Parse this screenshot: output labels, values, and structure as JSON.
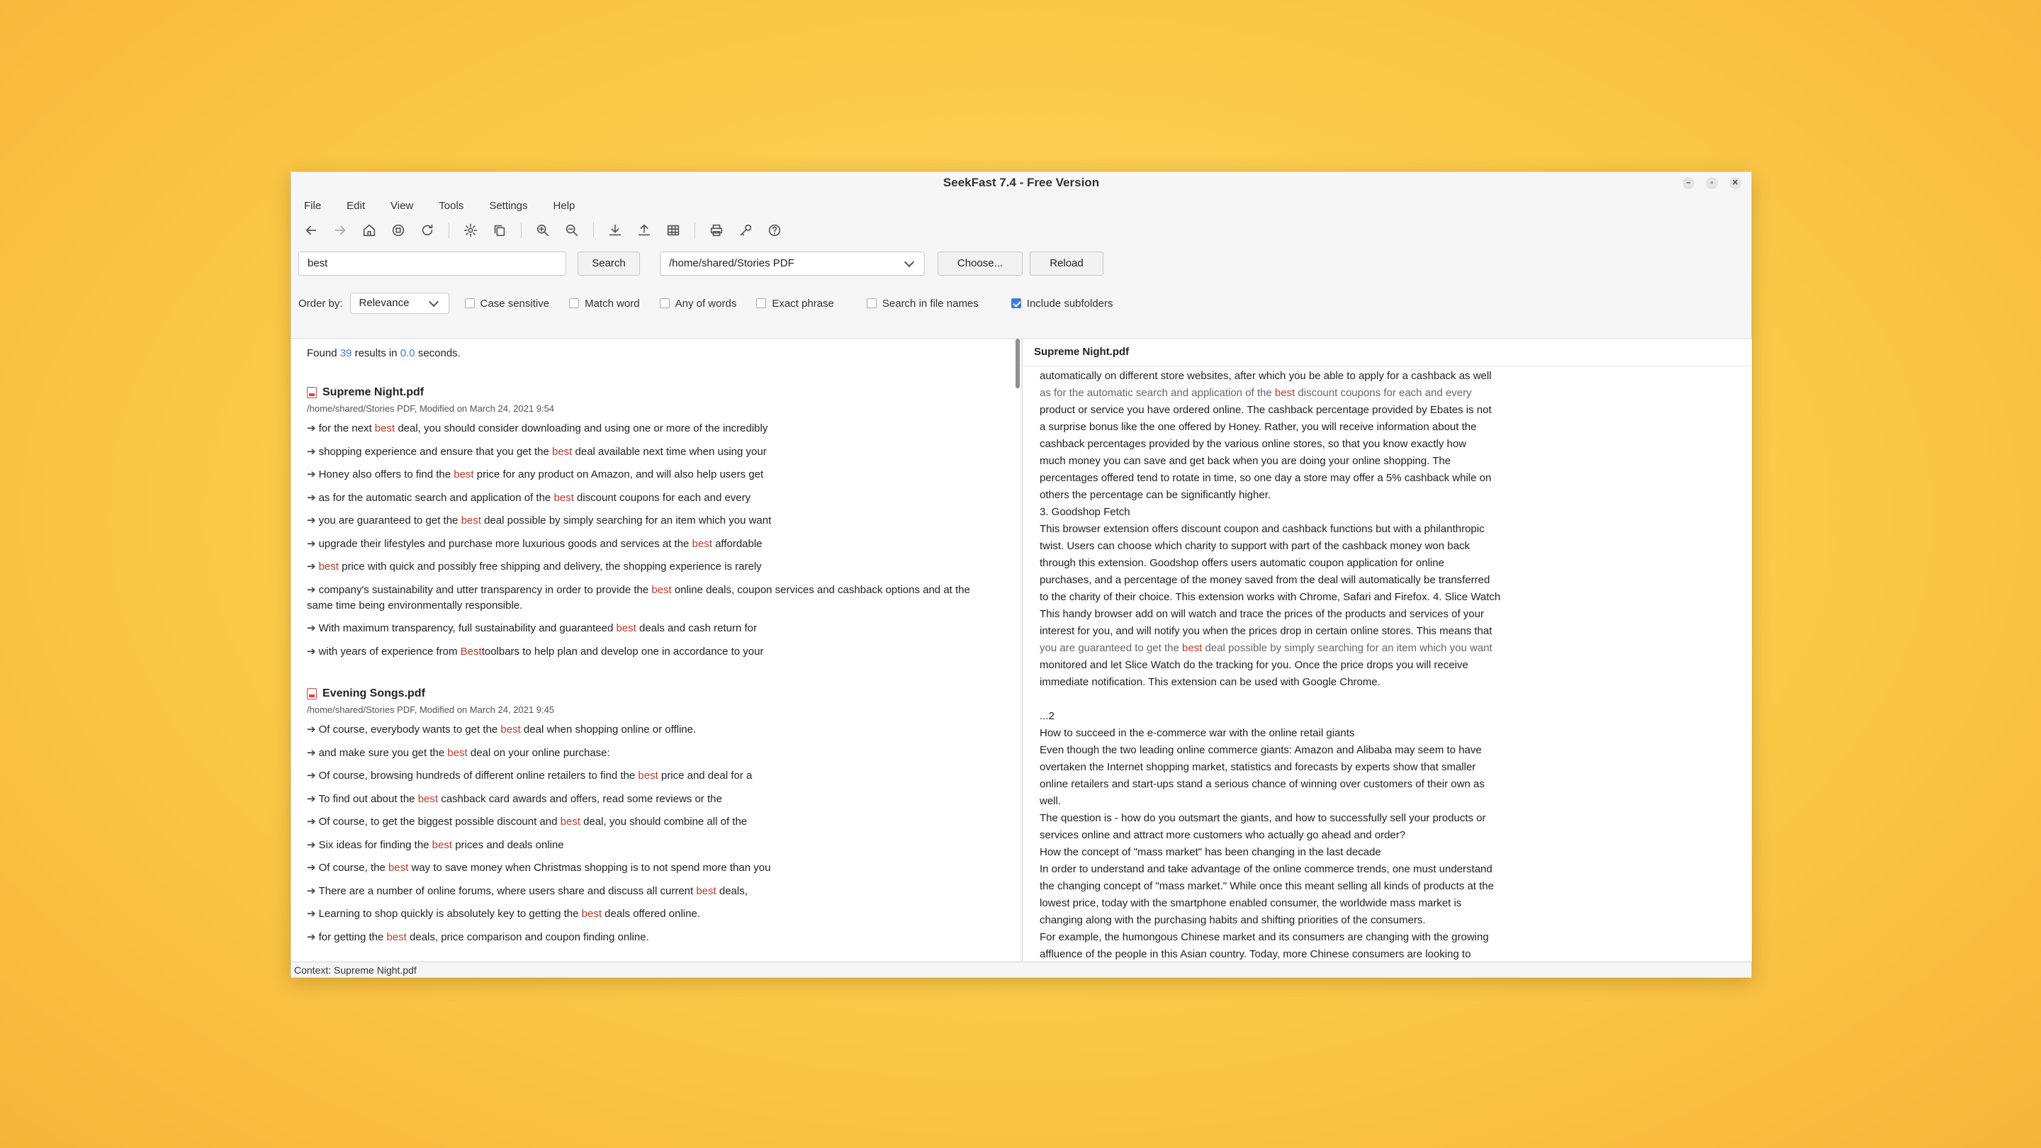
{
  "app": {
    "title": "SeekFast 7.4 - Free Version"
  },
  "menu": [
    "File",
    "Edit",
    "View",
    "Tools",
    "Settings",
    "Help"
  ],
  "toolbar_icons": [
    "back-icon",
    "forward-icon",
    "home-icon",
    "stop-icon",
    "refresh-icon",
    "settings-icon",
    "copy-icon",
    "zoom-in-icon",
    "zoom-out-icon",
    "import-icon",
    "export-icon",
    "table-icon",
    "print-icon",
    "key-icon",
    "help-icon"
  ],
  "search": {
    "query": "best",
    "search_label": "Search",
    "folder": "/home/shared/Stories PDF",
    "choose_label": "Choose...",
    "reload_label": "Reload"
  },
  "options": {
    "order_label": "Order by:",
    "order_value": "Relevance",
    "case_sensitive": "Case sensitive",
    "match_word": "Match word",
    "any_of_words": "Any of words",
    "exact_phrase": "Exact phrase",
    "search_file_names": "Search in file names",
    "include_subfolders": "Include subfolders"
  },
  "results": {
    "found_prefix": "Found",
    "count": "39",
    "found_mid": "results in",
    "seconds": "0.0",
    "found_suffix": "seconds.",
    "files": [
      {
        "name": "Supreme Night.pdf",
        "path": "/home/shared/Stories PDF, Modified on March 24, 2021 9:54",
        "hits": [
          [
            "for the next ",
            "best",
            " deal, you should consider downloading and using one or more of the incredibly"
          ],
          [
            "shopping experience and ensure that you get the ",
            "best",
            " deal available next time when using your"
          ],
          [
            "Honey also offers to find the ",
            "best",
            " price for any product on Amazon, and will also help users get"
          ],
          [
            "as for the automatic search and application of the ",
            "best",
            " discount coupons for each and every"
          ],
          [
            "you are guaranteed to get the ",
            "best",
            " deal possible by simply searching for an item which you want"
          ],
          [
            "upgrade their lifestyles and purchase more luxurious goods and services at the ",
            "best",
            " affordable"
          ],
          [
            "",
            "best",
            " price with quick and possibly free shipping and delivery, the shopping experience is rarely"
          ],
          [
            "company's sustainability and utter transparency in order to provide the ",
            "best",
            " online deals, coupon services and cashback options and at the same time being environmentally responsible."
          ],
          [
            "With maximum transparency, full sustainability and guaranteed ",
            "best",
            " deals and cash return for"
          ],
          [
            "with years of experience from ",
            "Best",
            "toolbars to help plan and develop one in accordance to your"
          ]
        ]
      },
      {
        "name": "Evening Songs.pdf",
        "path": "/home/shared/Stories PDF, Modified on March 24, 2021 9:45",
        "hits": [
          [
            "Of course, everybody wants to get the ",
            "best",
            " deal when shopping online or offline."
          ],
          [
            "and make sure you get the ",
            "best",
            " deal on your online purchase:"
          ],
          [
            "Of course, browsing hundreds of different online retailers to find the ",
            "best",
            " price and deal for a"
          ],
          [
            "To find out about the ",
            "best",
            " cashback card awards and offers, read some reviews or the"
          ],
          [
            "Of course, to get the biggest possible discount and ",
            "best",
            " deal, you should combine all of the"
          ],
          [
            "Six ideas for finding the ",
            "best",
            " prices and deals online"
          ],
          [
            "Of course, the ",
            "best",
            " way to save money when Christmas shopping is to not spend more than you"
          ],
          [
            "There are a number of online forums, where users share and discuss all current ",
            "best",
            " deals,"
          ],
          [
            "Learning to shop quickly is absolutely key to getting the ",
            "best",
            " deals offered online."
          ],
          [
            "for getting the ",
            "best",
            " deals, price comparison and coupon finding online."
          ]
        ]
      }
    ]
  },
  "preview": {
    "file": "Supreme Night.pdf",
    "lines_top": [
      "automatically on different store websites, after which you be able to apply for a cashback as well"
    ],
    "hl_line": [
      "as for the automatic search and application of the ",
      "best",
      " discount coupons for each and every"
    ],
    "lines_mid": [
      "product or service you have ordered online. The cashback percentage provided by Ebates is not",
      "a surprise bonus like the one offered by Honey. Rather, you will receive information about the",
      "cashback percentages provided by the various online stores, so that you know exactly how",
      "much money you can save and get back when you are doing your online shopping. The",
      "percentages offered tend to rotate in time, so one day a store may offer a 5% cashback while on",
      "others the percentage can be significantly higher.",
      "3. Goodshop Fetch",
      "This browser extension offers discount coupon and cashback functions but with a philanthropic",
      "twist. Users can choose which charity to support with part of the cashback money won back",
      "through this extension. Goodshop offers users automatic coupon application for online",
      "purchases, and a percentage of the money saved from the deal will automatically be transferred",
      "to the charity of their choice. This extension works with Chrome, Safari and Firefox. 4. Slice Watch",
      "This handy browser add on will watch and trace the prices of the products and services of your",
      "interest for you, and will notify you when the prices drop in certain online stores. This means that"
    ],
    "hl_line2": [
      "you are guaranteed to get the ",
      "best",
      " deal possible by simply searching for an item which you want"
    ],
    "lines_bottom": [
      "monitored and let Slice Watch do the tracking for you. Once the price drops you will receive",
      "immediate notification. This extension can be used with Google Chrome.",
      "",
      "...2",
      "How to succeed in the e-commerce war with the online retail giants",
      "Even though the two leading online commerce giants: Amazon and Alibaba may seem to have",
      "overtaken the Internet shopping market, statistics and forecasts by experts show that smaller",
      "online retailers and start-ups stand a serious chance of winning over customers of their own as",
      "well.",
      "The question is - how do you outsmart the giants, and how to successfully sell your products or",
      "services online and attract more customers who actually go ahead and order?",
      "How the concept of \"mass market\" has been changing in the last decade",
      "In order to understand and take advantage of the online commerce trends, one must understand",
      "the changing concept of \"mass market.\" While once this meant selling all kinds of products at the",
      "lowest price, today with the smartphone enabled consumer, the worldwide mass market is",
      "changing along with the purchasing habits and shifting priorities of the consumers.",
      "For example, the humongous Chinese market and its consumers are changing with the growing",
      "affluence of the people in this Asian country. Today, more Chinese consumers are looking to"
    ]
  },
  "status": "Context: Supreme Night.pdf",
  "colors": {
    "accent": "#3d7dd8",
    "match": "#c0392b",
    "background": "#fbc947"
  }
}
